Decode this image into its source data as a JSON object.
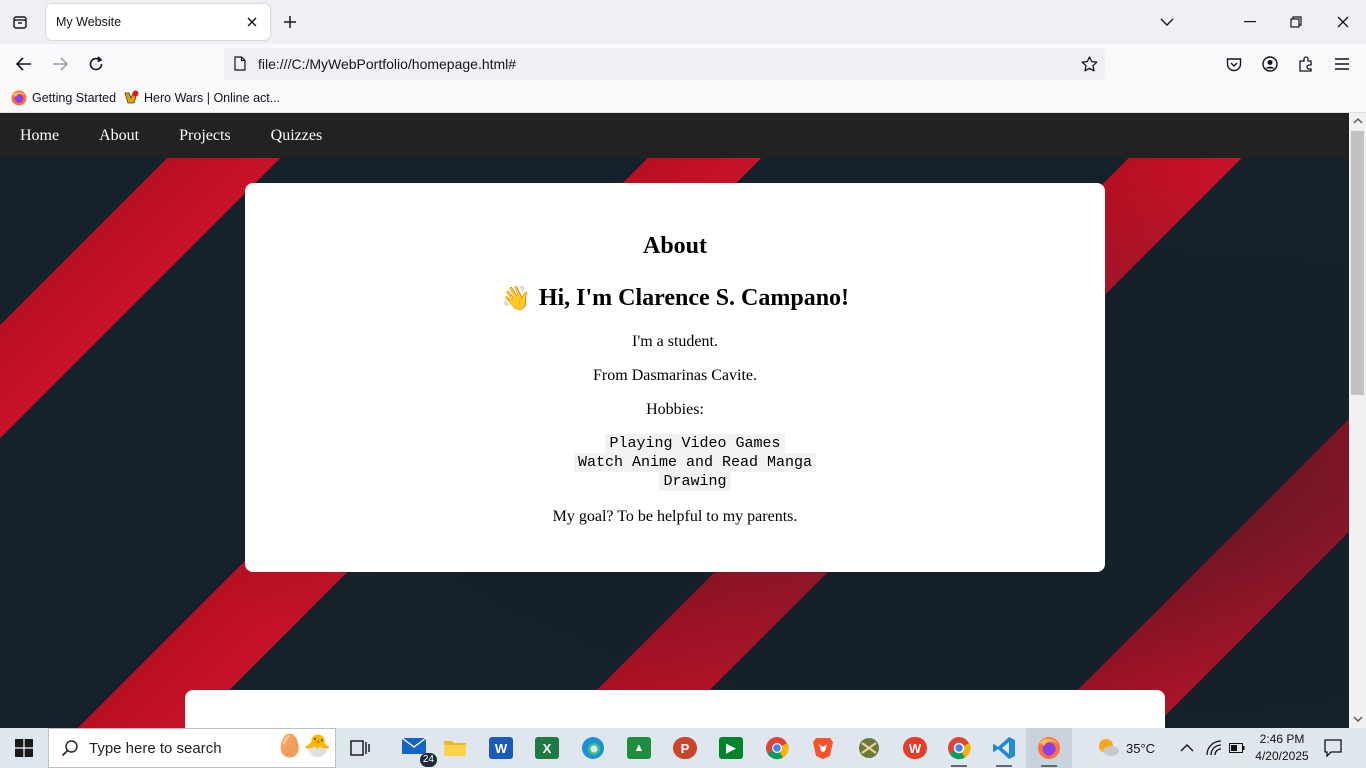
{
  "browser": {
    "tab_title": "My Website",
    "url": "file:///C:/MyWebPortfolio/homepage.html#",
    "bookmarks": [
      {
        "label": "Getting Started",
        "icon": "firefox-icon"
      },
      {
        "label": "Hero Wars | Online act...",
        "icon": "hero-wars-icon"
      }
    ]
  },
  "site": {
    "nav": [
      "Home",
      "About",
      "Projects",
      "Quizzes"
    ],
    "card": {
      "title": "About",
      "wave": "👋",
      "greeting": "Hi, I'm Clarence S. Campano!",
      "line1": "I'm a student.",
      "line2": "From Dasmarinas Cavite.",
      "hobbies_label": "Hobbies:",
      "hobbies": [
        "Playing Video Games",
        "Watch Anime and Read Manga",
        "Drawing"
      ],
      "goal": "My goal? To be helpful to my parents."
    }
  },
  "taskbar": {
    "search_placeholder": "Type here to search",
    "mail_badge": "24",
    "temperature": "35°C",
    "time": "2:46 PM",
    "date": "4/20/2025"
  },
  "colors": {
    "page_stripe_red": "#c81228",
    "page_stripe_dark": "#15212b",
    "site_nav_bg": "#222222"
  }
}
